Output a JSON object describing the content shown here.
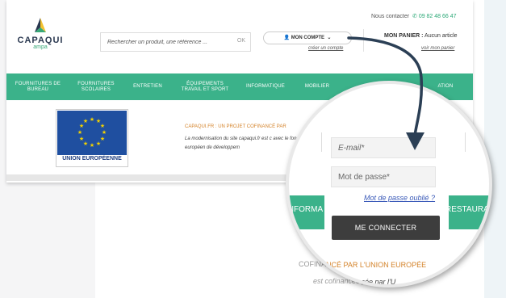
{
  "header": {
    "logo_name": "CAPAQUI",
    "logo_sub": "ampa",
    "search_placeholder": "Rechercher un produit, une référence ...",
    "search_ok": "OK",
    "contact_label": "Nous contacter",
    "contact_phone": "09 82 48 66 47",
    "account_button": "MON COMPTE",
    "account_link": "créer un compte",
    "cart_title": "MON PANIER :",
    "cart_status": "Aucun article",
    "cart_link": "voir mon panier"
  },
  "nav": [
    {
      "label": "FOURNITURES DE BUREAU"
    },
    {
      "label": "FOURNITURES SCOLAIRES"
    },
    {
      "label": "ENTRETIEN"
    },
    {
      "label": "ÉQUIPEMENTS TRAVAIL ET SPORT"
    },
    {
      "label": "INFORMATIQUE"
    },
    {
      "label": "MOBILIER"
    },
    {
      "label": "ATION"
    }
  ],
  "content": {
    "flag_label": "UNION EUROPÉENNE",
    "cofi_title": "CAPAQUI.FR : UN PROJET COFINANCÉ PAR",
    "cofi_text": "La modernisation du site capaqui.fr est c avec le fonds européen de développem",
    "bottom_title": "COFINANCÉ PAR L'UNION EUROPÉE",
    "bottom_text": "est cofinancée par l'"
  },
  "zoom": {
    "nav_left": "INFORMA",
    "nav_right": "RESTAURAT",
    "email_placeholder": "E-mail*",
    "password_placeholder": "Mot de passe*",
    "forgot_link": "Mot de passe oublié ?",
    "connect_button": "ME CONNECTER",
    "cofi_title": "COFINANCÉ PAR L'UNION EUROPÉE",
    "cofi_text": "est cofinancée par l'U"
  },
  "colors": {
    "accent_green": "#3bb28a",
    "eu_blue": "#1f4fa0",
    "orange": "#d4832a",
    "button_dark": "#3d3d3d",
    "arrow": "#2b3f55"
  }
}
